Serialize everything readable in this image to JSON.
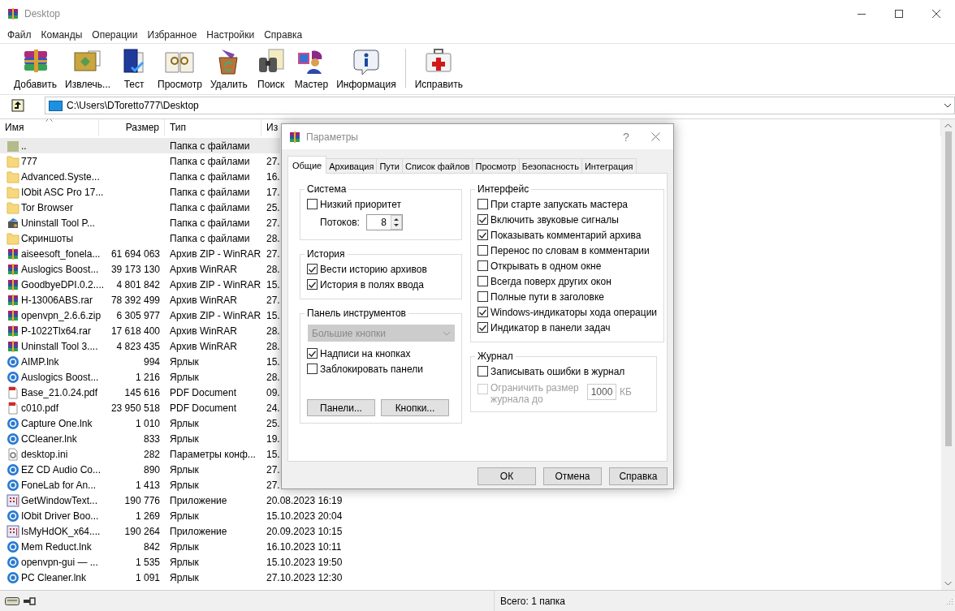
{
  "window": {
    "title": "Desktop"
  },
  "menu": [
    "Файл",
    "Команды",
    "Операции",
    "Избранное",
    "Настройки",
    "Справка"
  ],
  "toolbar": {
    "groups": [
      [
        {
          "label": "Добавить"
        },
        {
          "label": "Извлечь..."
        },
        {
          "label": "Тест"
        },
        {
          "label": "Просмотр"
        },
        {
          "label": "Удалить"
        },
        {
          "label": "Поиск"
        },
        {
          "label": "Мастер"
        },
        {
          "label": "Информация"
        }
      ],
      [
        {
          "label": "Исправить"
        }
      ]
    ]
  },
  "address": {
    "path": "C:\\Users\\DToretto777\\Desktop"
  },
  "files": {
    "columns": [
      {
        "label": "Имя",
        "sorted": true
      },
      {
        "label": "Размер",
        "sorted": false
      },
      {
        "label": "Тип",
        "sorted": false
      },
      {
        "label": "Из",
        "sorted": false
      }
    ],
    "rows": [
      {
        "kind": "parent",
        "name": "..",
        "type": "Папка с файлами",
        "selected": true
      },
      {
        "kind": "folder",
        "name": "777",
        "type": "Папка с файлами",
        "modified": "27.",
        "selected": false
      },
      {
        "kind": "folder",
        "name": "Advanced.Syste...",
        "type": "Папка с файлами",
        "modified": "16.",
        "selected": false
      },
      {
        "kind": "folder",
        "name": "IObit ASC Pro 17...",
        "type": "Папка с файлами",
        "modified": "17.",
        "selected": false
      },
      {
        "kind": "folder",
        "name": "Tor Browser",
        "type": "Папка с файлами",
        "modified": "25.",
        "selected": false
      },
      {
        "kind": "app-folder",
        "name": "Uninstall Tool P...",
        "type": "Папка с файлами",
        "modified": "27.",
        "selected": false
      },
      {
        "kind": "folder",
        "name": "Скриншоты",
        "type": "Папка с файлами",
        "modified": "28.",
        "selected": false
      },
      {
        "kind": "archive",
        "name": "aiseesoft_fonela...",
        "size": "61 694 063",
        "type": "Архив ZIP - WinRAR",
        "modified": "27.",
        "selected": false
      },
      {
        "kind": "archive",
        "name": "Auslogics Boost...",
        "size": "39 173 130",
        "type": "Архив WinRAR",
        "modified": "28.",
        "selected": false
      },
      {
        "kind": "archive",
        "name": "GoodbyeDPI.0.2....",
        "size": "4 801 842",
        "type": "Архив ZIP - WinRAR",
        "modified": "15.",
        "selected": false
      },
      {
        "kind": "archive",
        "name": "H-13006ABS.rar",
        "size": "78 392 499",
        "type": "Архив WinRAR",
        "modified": "27.",
        "selected": false
      },
      {
        "kind": "archive",
        "name": "openvpn_2.6.6.zip",
        "size": "6 305 977",
        "type": "Архив ZIP - WinRAR",
        "modified": "15.",
        "selected": false
      },
      {
        "kind": "archive",
        "name": "P-1022Tlx64.rar",
        "size": "17 618 400",
        "type": "Архив WinRAR",
        "modified": "28.",
        "selected": false
      },
      {
        "kind": "archive",
        "name": "Uninstall Tool 3....",
        "size": "4 823 435",
        "type": "Архив WinRAR",
        "modified": "28.",
        "selected": false
      },
      {
        "kind": "shortcut",
        "name": "AIMP.lnk",
        "size": "994",
        "type": "Ярлык",
        "modified": "15.",
        "selected": false
      },
      {
        "kind": "shortcut",
        "name": "Auslogics Boost...",
        "size": "1 216",
        "type": "Ярлык",
        "modified": "28.",
        "selected": false
      },
      {
        "kind": "pdf",
        "name": "Base_21.0.24.pdf",
        "size": "145 616",
        "type": "PDF Document",
        "modified": "09.",
        "selected": false
      },
      {
        "kind": "pdf",
        "name": "c010.pdf",
        "size": "23 950 518",
        "type": "PDF Document",
        "modified": "24.",
        "selected": false
      },
      {
        "kind": "shortcut",
        "name": "Capture One.lnk",
        "size": "1 010",
        "type": "Ярлык",
        "modified": "25.",
        "selected": false
      },
      {
        "kind": "shortcut",
        "name": "CCleaner.lnk",
        "size": "833",
        "type": "Ярлык",
        "modified": "19.",
        "selected": false
      },
      {
        "kind": "settings",
        "name": "desktop.ini",
        "size": "282",
        "type": "Параметры конф...",
        "modified": "15.",
        "selected": false
      },
      {
        "kind": "shortcut",
        "name": "EZ CD Audio Co...",
        "size": "890",
        "type": "Ярлык",
        "modified": "27.",
        "selected": false
      },
      {
        "kind": "shortcut",
        "name": "FoneLab for An...",
        "size": "1 413",
        "type": "Ярлык",
        "modified": "27.",
        "selected": false
      },
      {
        "kind": "app",
        "name": "GetWindowText...",
        "size": "190 776",
        "type": "Приложение",
        "modified": "20.08.2023 16:19",
        "selected": false
      },
      {
        "kind": "shortcut",
        "name": "IObit Driver Boo...",
        "size": "1 269",
        "type": "Ярлык",
        "modified": "15.10.2023 20:04",
        "selected": false
      },
      {
        "kind": "app",
        "name": "IsMyHdOK_x64....",
        "size": "190 264",
        "type": "Приложение",
        "modified": "20.09.2023 10:15",
        "selected": false
      },
      {
        "kind": "shortcut",
        "name": "Mem Reduct.lnk",
        "size": "842",
        "type": "Ярлык",
        "modified": "16.10.2023 10:11",
        "selected": false
      },
      {
        "kind": "shortcut",
        "name": "openvpn-gui — ...",
        "size": "1 535",
        "type": "Ярлык",
        "modified": "15.10.2023 19:50",
        "selected": false
      },
      {
        "kind": "shortcut",
        "name": "PC Cleaner.lnk",
        "size": "1 091",
        "type": "Ярлык",
        "modified": "27.10.2023 12:30",
        "selected": false
      }
    ]
  },
  "status_bar": {
    "text": "Всего: 1 папка"
  },
  "dialog": {
    "title": "Параметры",
    "help": "?",
    "tabs": [
      {
        "label": "Общие",
        "selected": true
      },
      {
        "label": "Архивация",
        "selected": false
      },
      {
        "label": "Пути",
        "selected": false
      },
      {
        "label": "Список файлов",
        "selected": false
      },
      {
        "label": "Просмотр",
        "selected": false
      },
      {
        "label": "Безопасность",
        "selected": false
      },
      {
        "label": "Интеграция",
        "selected": false
      }
    ],
    "columns": [
      [
        {
          "title": "Система",
          "items": [
            {
              "kind": "checkbox",
              "label": "Низкий приоритет",
              "checked": false
            },
            {
              "kind": "spinner",
              "label": "Потоков:",
              "value": "8"
            }
          ]
        },
        {
          "title": "История",
          "items": [
            {
              "kind": "checkbox",
              "label": "Вести историю архивов",
              "checked": true
            },
            {
              "kind": "checkbox",
              "label": "История в полях ввода",
              "checked": true
            }
          ]
        },
        {
          "title": "Панель инструментов",
          "items": [
            {
              "kind": "dropdown",
              "value": "Большие кнопки",
              "disabled": true
            },
            {
              "kind": "checkbox",
              "label": "Надписи на кнопках",
              "checked": true
            },
            {
              "kind": "checkbox",
              "label": "Заблокировать панели",
              "checked": false
            },
            {
              "kind": "buttons",
              "labels": [
                "Панели...",
                "Кнопки..."
              ]
            }
          ]
        }
      ],
      [
        {
          "title": "Интерфейс",
          "items": [
            {
              "kind": "checkbox",
              "label": "При старте запускать мастера",
              "checked": false
            },
            {
              "kind": "checkbox",
              "label": "Включить звуковые сигналы",
              "checked": true
            },
            {
              "kind": "checkbox",
              "label": "Показывать комментарий архива",
              "checked": true
            },
            {
              "kind": "checkbox",
              "label": "Перенос по словам в комментарии",
              "checked": false
            },
            {
              "kind": "checkbox",
              "label": "Открывать в одном окне",
              "checked": false
            },
            {
              "kind": "checkbox",
              "label": "Всегда поверх других окон",
              "checked": false
            },
            {
              "kind": "checkbox",
              "label": "Полные пути в заголовке",
              "checked": false
            },
            {
              "kind": "checkbox",
              "label": "Windows-индикаторы хода операции",
              "checked": true
            },
            {
              "kind": "checkbox",
              "label": "Индикатор в панели задач",
              "checked": true
            }
          ]
        },
        {
          "title": "Журнал",
          "items": [
            {
              "kind": "checkbox",
              "label": "Записывать ошибки в журнал",
              "checked": false
            },
            {
              "kind": "limit",
              "label": "Ограничить размер журнала до",
              "checked": false,
              "disabled": true,
              "value": "1000",
              "unit": "КБ"
            }
          ]
        }
      ]
    ],
    "buttons": [
      "ОК",
      "Отмена",
      "Справка"
    ]
  }
}
